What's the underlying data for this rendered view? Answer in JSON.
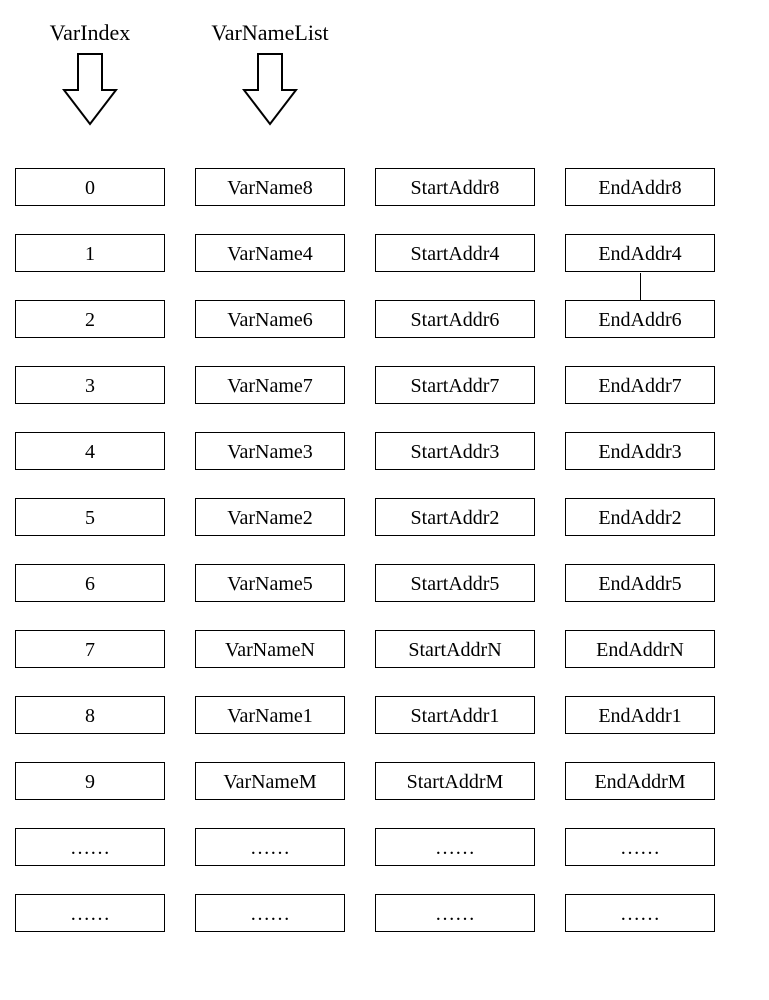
{
  "headers": {
    "varIndex": "VarIndex",
    "varNameList": "VarNameList"
  },
  "rows": [
    {
      "index": "0",
      "name": "VarName8",
      "start": "StartAddr8",
      "end": "EndAddr8"
    },
    {
      "index": "1",
      "name": "VarName4",
      "start": "StartAddr4",
      "end": "EndAddr4"
    },
    {
      "index": "2",
      "name": "VarName6",
      "start": "StartAddr6",
      "end": "EndAddr6"
    },
    {
      "index": "3",
      "name": "VarName7",
      "start": "StartAddr7",
      "end": "EndAddr7"
    },
    {
      "index": "4",
      "name": "VarName3",
      "start": "StartAddr3",
      "end": "EndAddr3"
    },
    {
      "index": "5",
      "name": "VarName2",
      "start": "StartAddr2",
      "end": "EndAddr2"
    },
    {
      "index": "6",
      "name": "VarName5",
      "start": "StartAddr5",
      "end": "EndAddr5"
    },
    {
      "index": "7",
      "name": "VarNameN",
      "start": "StartAddrN",
      "end": "EndAddrN"
    },
    {
      "index": "8",
      "name": "VarName1",
      "start": "StartAddr1",
      "end": "EndAddr1"
    },
    {
      "index": "9",
      "name": "VarNameM",
      "start": "StartAddrM",
      "end": "EndAddrM"
    },
    {
      "index": "……",
      "name": "……",
      "start": "……",
      "end": "……"
    },
    {
      "index": "……",
      "name": "……",
      "start": "……",
      "end": "……"
    }
  ],
  "connector_after_row_index": 1
}
